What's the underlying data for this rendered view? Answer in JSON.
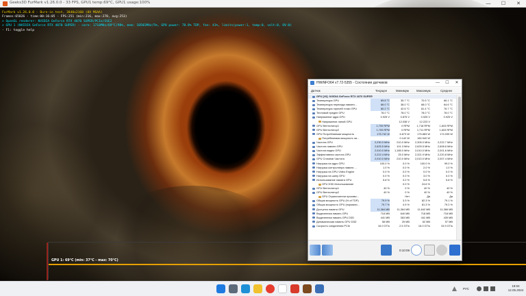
{
  "furmark": {
    "title": "Geeks3D FurMark v1.26.0.0 - 33 FPS, GPU1 temp:69°C, GPU1 usage:100%",
    "osd": [
      {
        "text": "FurMark v1.26.0.0 - Burn-in test, 3840x2160 (8X MSAA)",
        "color": "#f5d000"
      },
      {
        "text": "Frames:65826 - time:00:16:05 - FPS:251 (min:216, max:278, avg:253)",
        "color": "#ffffff"
      },
      {
        "text": "> OpenGL renderer: NVIDIA GeForce RTX 4070 SUPER/PCIe/SSE2",
        "color": "#00e5ff"
      },
      {
        "text": "> GPU 1 (NVIDIA GeForce RTX 4070 SUPER) - core: 1710MHz/69°C/98%, mem: 10501MHz/5%, GPU power: 78.8% TDP, fan: 41%, limits(power:1, temp:0, volt:0, OV:0)",
        "color": "#00e5ff"
      },
      {
        "text": "- F1: toggle help",
        "color": "#ffffff"
      }
    ],
    "graph_label": "GPU 1: 69°C (min: 37°C - max: 70°C)"
  },
  "hwinfo": {
    "title": "HWiNFO64 v7.72-5355 - Состояние датчиков",
    "columns": [
      "Датчик",
      "Текущее",
      "Минимум",
      "Максимум",
      "Среднее"
    ],
    "rows": [
      {
        "type": "group",
        "name": "GPU [#0]: NVIDIA GeForce RTX 4070 SUPER"
      },
      {
        "name": "Температура GPU",
        "cur": "69.8 °C",
        "min": "35.7 °C",
        "max": "70.5 °C",
        "avg": "66.1 °C"
      },
      {
        "name": "Температура перехода памяти...",
        "cur": "66.0 °C",
        "min": "38.0 °C",
        "max": "68.0 °C",
        "avg": "64.6 °C"
      },
      {
        "name": "Температура горячей точки GPU",
        "cur": "80.2 °C",
        "min": "42.6 °C",
        "max": "81.4 °C",
        "avg": "76.7 °C"
      },
      {
        "name": "Тепловой предел GPU",
        "cur": "78.0 °C",
        "min": "78.0 °C",
        "max": "78.0 °C",
        "avg": "78.0 °C"
      },
      {
        "name": "Напряжение ядра GPU",
        "cur": "0.925 V",
        "min": "0.875 V",
        "max": "0.925 V",
        "avg": "0.925 V"
      },
      {
        "type": "sub",
        "name": "Напряжение линий GPU",
        "cur": "",
        "min": "12.038 V",
        "max": "12.223 V",
        "avg": ""
      },
      {
        "name": "GPU Вентилятор1",
        "cur": "1,709 RPM",
        "min": "0 RPM",
        "max": "1,718 RPM",
        "avg": "1,603 RPM"
      },
      {
        "name": "GPU Вентилятор2",
        "cur": "1,709 RPM",
        "min": "0 RPM",
        "max": "1,711 RPM",
        "avg": "1,603 RPM"
      },
      {
        "name": "GPU Потребляемая мощность",
        "cur": "175.742 W",
        "min": "6.673 W",
        "max": "175.883 W",
        "avg": "174.035 W"
      },
      {
        "type": "sub",
        "name": "Потребляемая мощность ли...",
        "cur": "",
        "min": "0.142 W",
        "max": "160.940 W",
        "avg": ""
      },
      {
        "name": "Частота GPU",
        "cur": "2,230.0 MHz",
        "min": "210.0 MHz",
        "max": "2,305.0 MHz",
        "avg": "2,222.7 MHz"
      },
      {
        "name": "Частота памяти GPU",
        "cur": "2,625.5 MHz",
        "min": "101.3 MHz",
        "max": "2,625.5 MHz",
        "avg": "2,608.6 MHz"
      },
      {
        "name": "Частота видео GPU",
        "cur": "2,010.0 MHz",
        "min": "1,185.0 MHz",
        "max": "2,010.0 MHz",
        "avg": "2,001.6 MHz"
      },
      {
        "name": "Эффективная частота GPU",
        "cur": "2,222.4 MHz",
        "min": "25.0 MHz",
        "max": "2,321.9 MHz",
        "avg": "2,220.8 MHz"
      },
      {
        "name": "GPU Crossbar Частота",
        "cur": "2,010.0 MHz",
        "min": "210.0 MHz",
        "max": "2,010.0 MHz",
        "avg": "2,007.4 MHz"
      },
      {
        "name": "Нагрузка на ядро GPU",
        "cur": "100.0 %",
        "min": "0.0 %",
        "max": "100.0 %",
        "avg": "99.0 %"
      },
      {
        "name": "Нагрузка контроллера памяти ...",
        "cur": "1.0 %",
        "min": "0.0 %",
        "max": "2.0 %",
        "avg": "1.0 %"
      },
      {
        "name": "Нагрузка на GPU Video Engine",
        "cur": "0.0 %",
        "min": "0.0 %",
        "max": "0.0 %",
        "avg": "0.0 %"
      },
      {
        "name": "Нагрузка на шину GPU",
        "cur": "0.0 %",
        "min": "0.0 %",
        "max": "3.0 %",
        "avg": "0.0 %"
      },
      {
        "name": "Использование памяти GPU",
        "cur": "5.8 %",
        "min": "3.2 %",
        "max": "5.8 %",
        "avg": "5.8 %"
      },
      {
        "type": "sub",
        "name": "GPU D3D Использование",
        "cur": "",
        "min": "0.0 %",
        "max": "24.6 %",
        "avg": ""
      },
      {
        "name": "GPU Вентилятор1",
        "cur": "40 %",
        "min": "0 %",
        "max": "40 %",
        "avg": "40 %"
      },
      {
        "name": "GPU Вентилятор2",
        "cur": "40 %",
        "min": "0 %",
        "max": "40 %",
        "avg": "40 %"
      },
      {
        "type": "sub",
        "name": "GPU Ограничители произво...",
        "cur": "",
        "min": "Нет",
        "max": "Да",
        "avg": "Да"
      },
      {
        "name": "Общая мощность GPU (% of TDP)",
        "cur": "79.9 %",
        "min": "3.3 %",
        "max": "82.3 %",
        "avg": "79.1 %"
      },
      {
        "name": "Общая мощность GPU (нормали...",
        "cur": "79.7 %",
        "min": "4.9 %",
        "max": "81.3 %",
        "avg": "79.2 %"
      },
      {
        "name": "Доступно памяти GPU",
        "cur": "11,364 MB",
        "min": "11,364 MB",
        "max": "11,642 MB",
        "avg": "11,366 MB"
      },
      {
        "name": "Выделенная память GPU",
        "cur": "718 MB",
        "min": "640 MB",
        "max": "718 MB",
        "avg": "718 MB"
      },
      {
        "name": "Выделенная память GPU D3D",
        "cur": "441 MB",
        "min": "363 MB",
        "max": "441 MB",
        "avg": "439 MB"
      },
      {
        "name": "Динамическая память GPU D3D",
        "cur": "58 MB",
        "min": "25 MB",
        "max": "62 MB",
        "avg": "57 MB"
      },
      {
        "name": "Скорость соединения PCIe",
        "cur": "16.0 GT/s",
        "min": "2.5 GT/s",
        "max": "16.0 GT/s",
        "avg": "15.9 GT/s"
      }
    ],
    "toolbar": {
      "time": "0:10:09"
    }
  },
  "taskbar": {
    "language": "РУС",
    "time": "18:04",
    "date": "12.05.2024"
  }
}
